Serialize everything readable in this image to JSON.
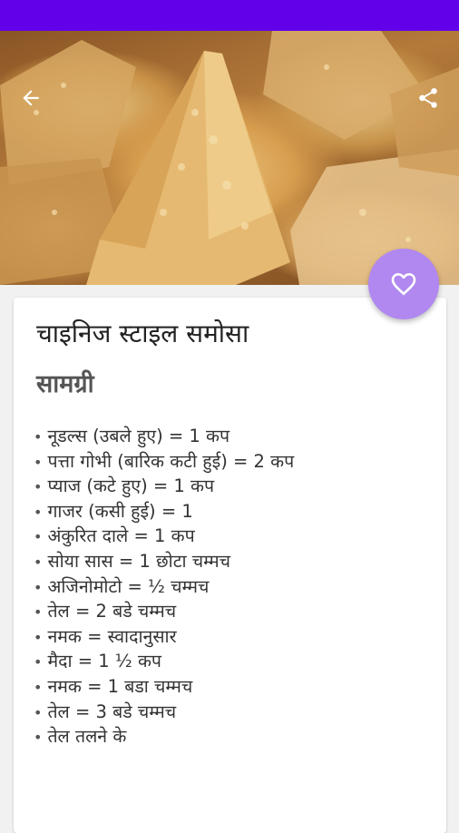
{
  "colors": {
    "status_bar": "#6200ea",
    "fab": "#b088f0",
    "card": "#ffffff",
    "background": "#f1f1f1"
  },
  "header": {
    "back_icon": "arrow-left-icon",
    "share_icon": "share-icon"
  },
  "hero": {
    "image": "samosa-photo"
  },
  "fab": {
    "icon": "heart-outline-icon"
  },
  "recipe": {
    "title": "चाइनिज स्टाइल समोसा",
    "section_heading": "सामग्री",
    "bullet": "•",
    "ingredients": [
      "नूडल्स (उबले हुए) = 1 कप",
      "पत्ता गोभी (बारिक कटी हुई) = 2 कप",
      "प्याज (कटे हुए) = 1 कप",
      "गाजर (कसी हुई) = 1",
      "अंकुरित दाले = 1 कप",
      "सोया सास = 1 छोटा चम्मच",
      "अजिनोमोटो = ½ चम्मच",
      "तेल = 2 बडे चम्मच",
      "नमक = स्वादानुसार",
      "मैदा = 1 ½ कप",
      "नमक = 1 बडा चम्मच",
      "तेल = 3 बडे चम्मच",
      "तेल तलने के"
    ]
  }
}
